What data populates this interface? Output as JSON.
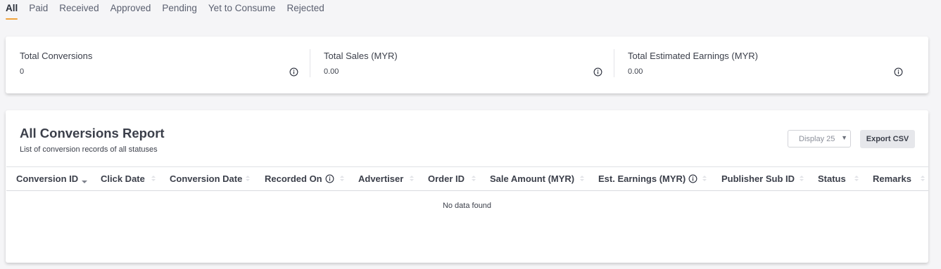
{
  "tabs": [
    {
      "label": "All",
      "active": true
    },
    {
      "label": "Paid"
    },
    {
      "label": "Received"
    },
    {
      "label": "Approved"
    },
    {
      "label": "Pending"
    },
    {
      "label": "Yet to Consume"
    },
    {
      "label": "Rejected"
    }
  ],
  "summary": {
    "total_conversions": {
      "label": "Total Conversions",
      "value": "0",
      "icon": "info-icon"
    },
    "total_sales": {
      "label": "Total Sales (MYR)",
      "value": "0.00",
      "icon": "info-icon"
    },
    "total_earnings": {
      "label": "Total Estimated Earnings (MYR)",
      "value": "0.00",
      "icon": "info-icon"
    }
  },
  "report": {
    "title": "All Conversions Report",
    "subtitle": "List of conversion records of all statuses",
    "display_select": "Display 25",
    "export_label": "Export CSV",
    "columns": [
      {
        "label": "Conversion ID",
        "sorted": "desc"
      },
      {
        "label": "Click Date"
      },
      {
        "label": "Conversion Date"
      },
      {
        "label": "Recorded On",
        "info": true
      },
      {
        "label": "Advertiser"
      },
      {
        "label": "Order ID"
      },
      {
        "label": "Sale Amount (MYR)"
      },
      {
        "label": "Est. Earnings (MYR)",
        "info": true
      },
      {
        "label": "Publisher Sub ID"
      },
      {
        "label": "Status"
      },
      {
        "label": "Remarks"
      }
    ],
    "empty_message": "No data found"
  },
  "colors": {
    "accent": "#f0a23a",
    "text": "#3b3f4a",
    "card": "#ffffff",
    "background": "#f5f5f7"
  }
}
